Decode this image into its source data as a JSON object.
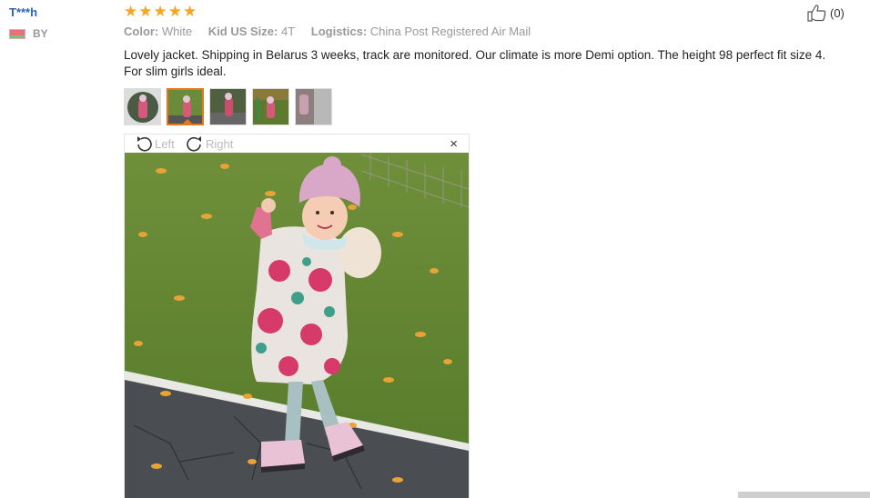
{
  "user": {
    "name": "T***h",
    "country": "BY"
  },
  "rating": {
    "stars": 5
  },
  "helpful": {
    "count": "(0)"
  },
  "attributes": [
    {
      "key": "Color:",
      "value": "White"
    },
    {
      "key": "Kid US Size:",
      "value": "4T"
    },
    {
      "key": "Logistics:",
      "value": "China Post Registered Air Mail"
    }
  ],
  "review": {
    "text": "Lovely jacket. Shipping in Belarus 3 weeks, track are monitored. Our climate is more Demi option. The height 98 perfect fit size 4. For slim girls ideal."
  },
  "viewer": {
    "rotate_left_label": "Left",
    "rotate_right_label": "Right",
    "close_icon": "×"
  },
  "colors": {
    "accent": "#e8761e",
    "star": "#f5a623",
    "user_link": "#2a63b4"
  }
}
